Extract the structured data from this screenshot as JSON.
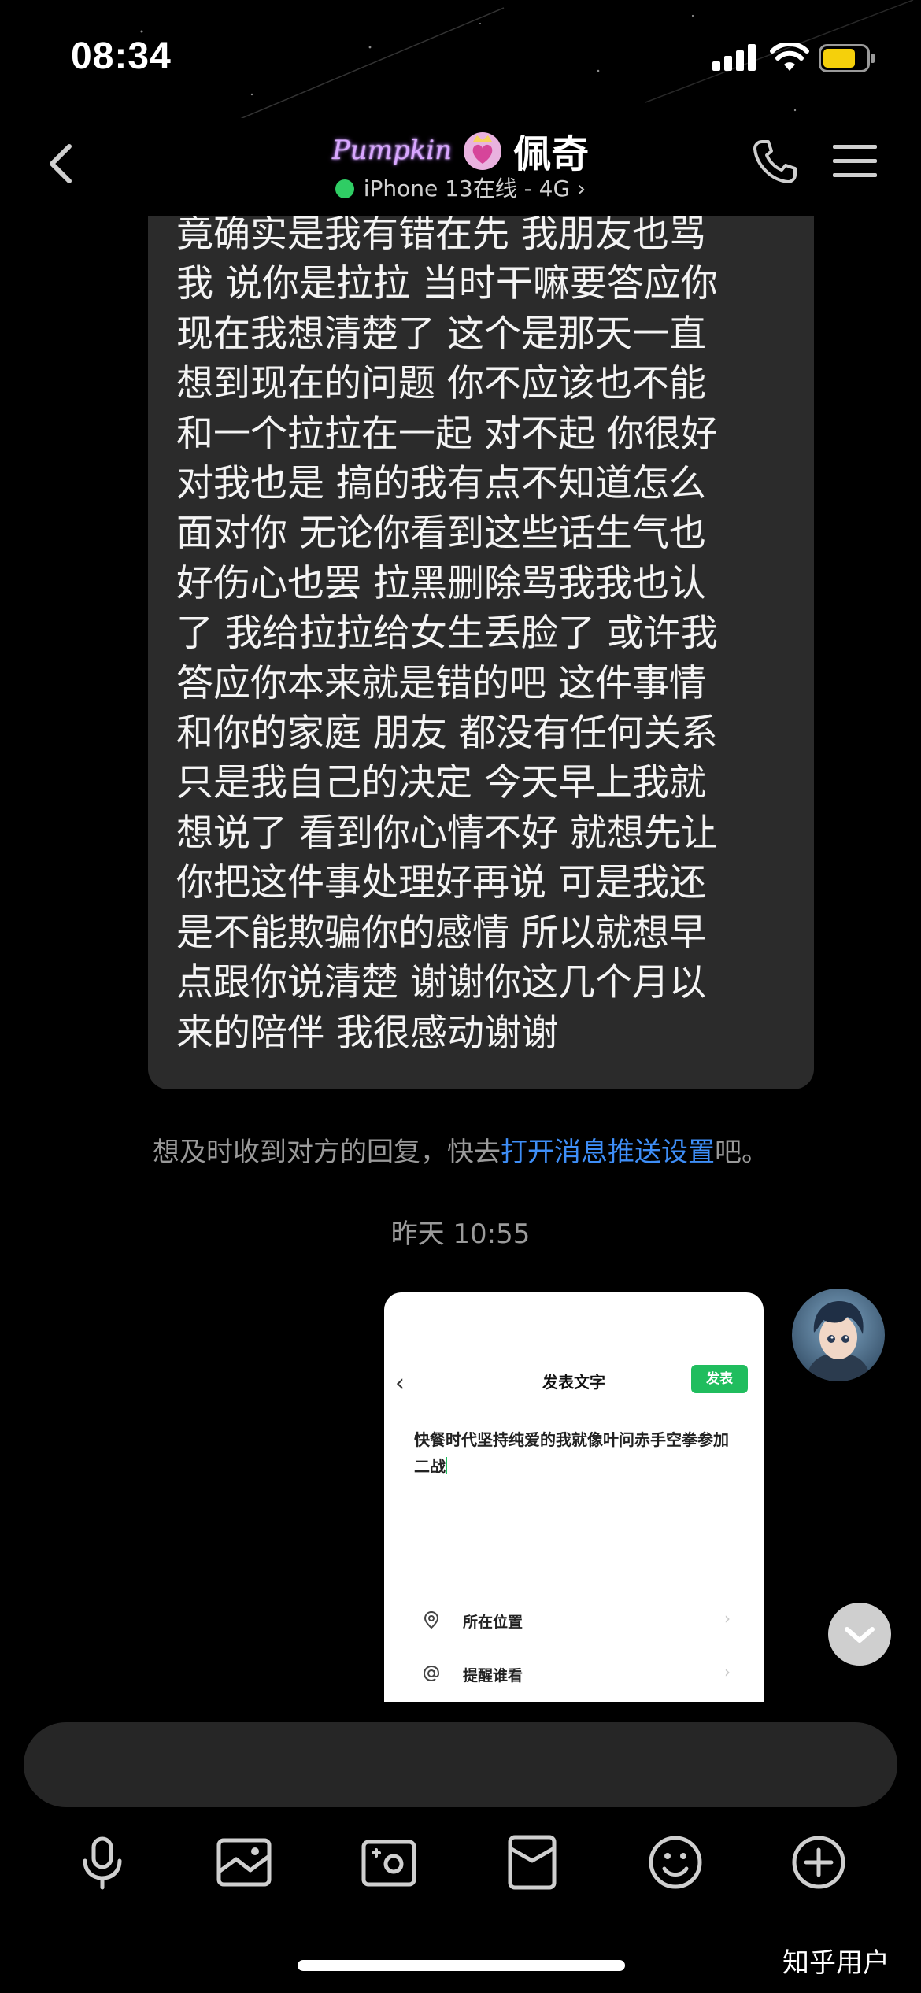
{
  "status_bar": {
    "time": "08:34"
  },
  "header": {
    "logo_text": "Pumpkin",
    "contact_name": "佩奇",
    "device_status": "iPhone 13在线 - 4G",
    "chevron": "›"
  },
  "message": {
    "text": "竟确实是我有错在先 我朋友也骂\n我 说你是拉拉 当时干嘛要答应你\n现在我想清楚了 这个是那天一直\n想到现在的问题 你不应该也不能\n和一个拉拉在一起 对不起 你很好\n对我也是 搞的我有点不知道怎么\n面对你 无论你看到这些话生气也\n好伤心也罢 拉黑删除骂我我也认\n了 我给拉拉给女生丢脸了 或许我\n答应你本来就是错的吧 这件事情\n和你的家庭 朋友 都没有任何关系\n只是我自己的决定 今天早上我就\n想说了 看到你心情不好 就想先让\n你把这件事处理好再说 可是我还\n是不能欺骗你的感情 所以就想早\n点跟你说清楚 谢谢你这几个月以\n来的陪伴 我很感动谢谢"
  },
  "notice": {
    "prefix": "想及时收到对方的回复，快去",
    "link": "打开消息推送设置",
    "suffix": "吧。"
  },
  "timestamp": "昨天 10:55",
  "screenshot": {
    "back": "‹",
    "title": "发表文字",
    "publish": "发表",
    "text": "快餐时代坚持纯爱的我就像叶问赤手空拳参加二战",
    "location_label": "所在位置",
    "remind_label": "提醒谁看",
    "chev": "›"
  },
  "icons": {
    "back": "chevron-left-icon",
    "phone": "phone-icon",
    "menu": "menu-icon",
    "voice": "microphone-icon",
    "image": "image-icon",
    "camera": "camera-icon",
    "red_packet": "red-packet-icon",
    "emoji": "emoji-icon",
    "more": "plus-circle-icon"
  },
  "colors": {
    "background": "#000000",
    "bubble": "#2b2b2b",
    "link": "#3e8ef7",
    "online": "#2fcd64",
    "battery": "#f5d00b",
    "publish": "#20bd5e"
  },
  "watermark": "知乎用户"
}
